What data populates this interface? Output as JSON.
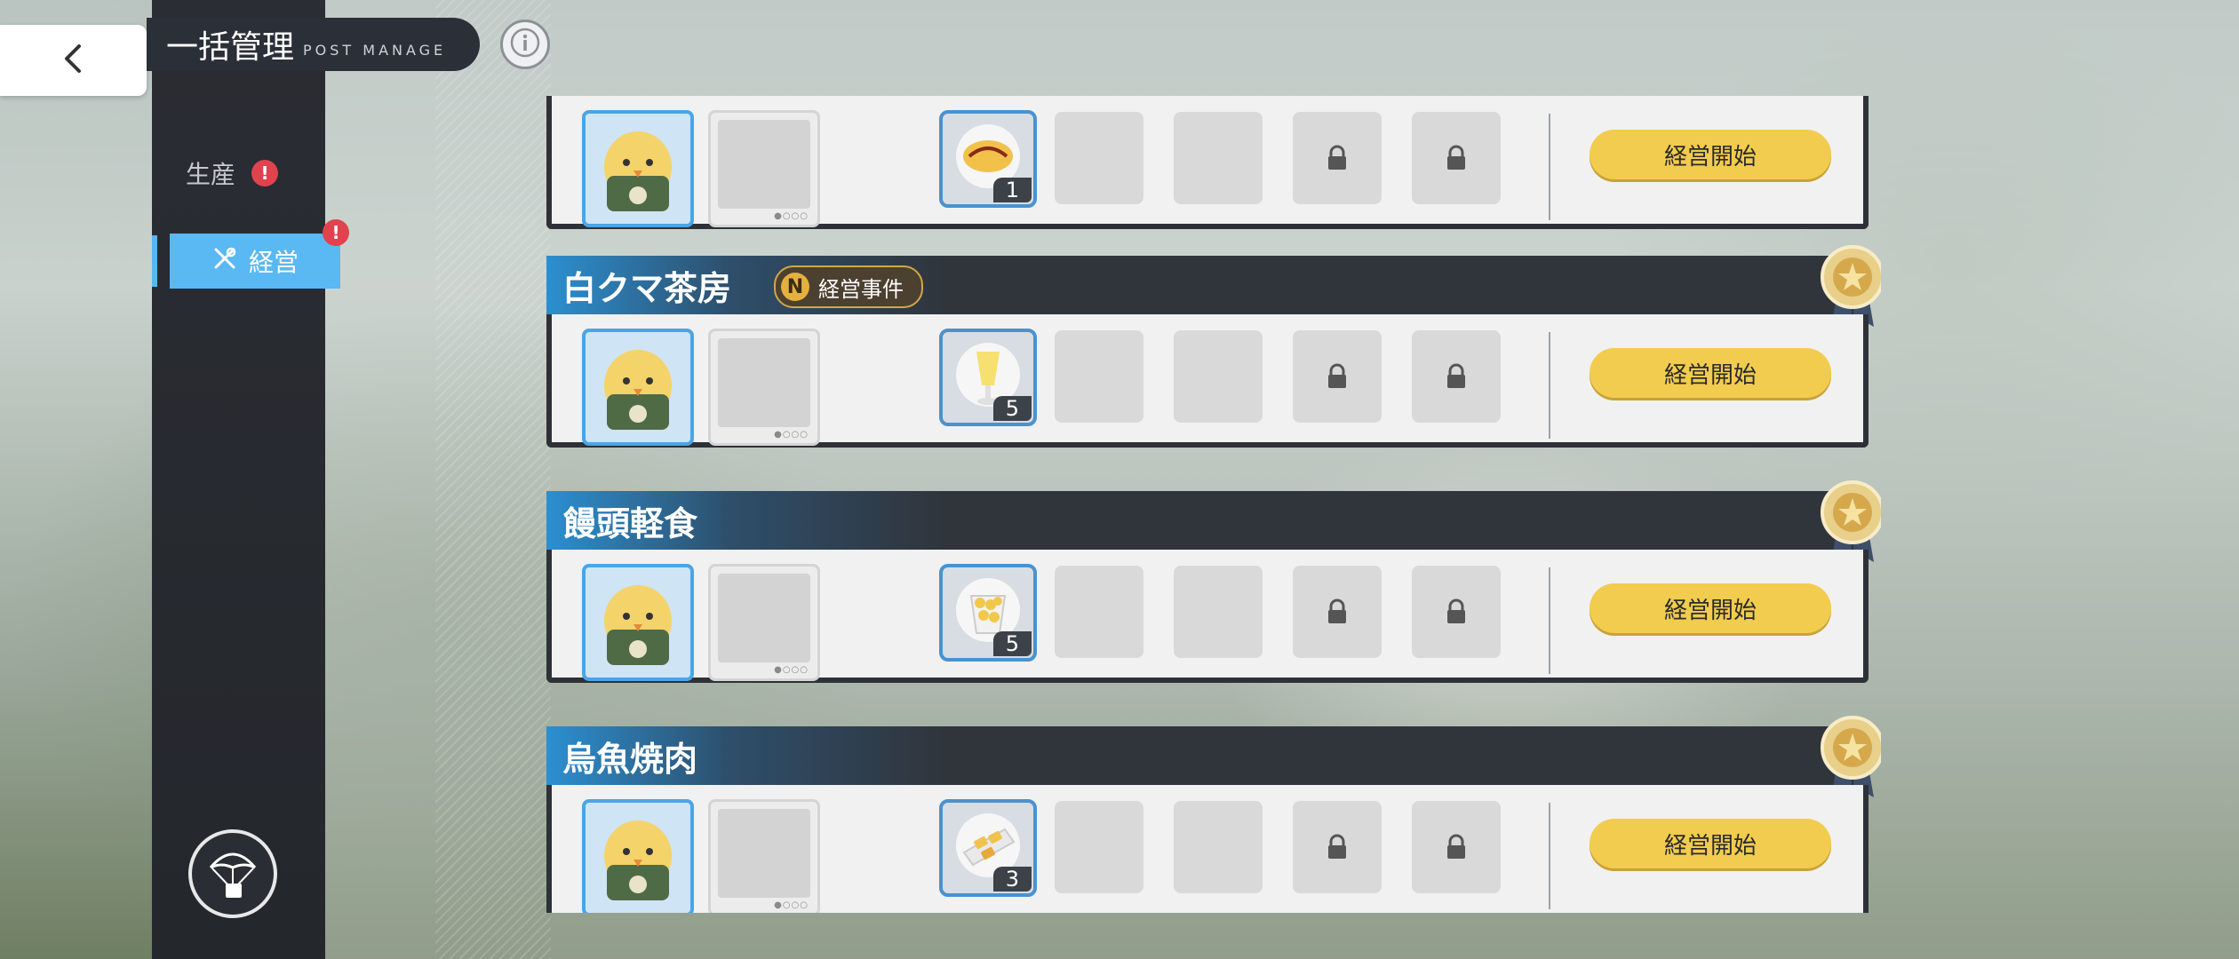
{
  "header": {
    "title": "一括管理",
    "subtitle": "POST MANAGE"
  },
  "sidebar": {
    "items": [
      {
        "label": "生産",
        "alert": "!"
      },
      {
        "label": "経営",
        "alert": "!"
      }
    ]
  },
  "cards": [
    {
      "name": "",
      "event": "",
      "item_count": "1",
      "button": "経営開始"
    },
    {
      "name": "白クマ茶房",
      "event": "経営事件",
      "event_rank": "N",
      "item_count": "5",
      "button": "経営開始"
    },
    {
      "name": "饅頭軽食",
      "event": "",
      "item_count": "5",
      "button": "経営開始"
    },
    {
      "name": "烏魚焼肉",
      "event": "",
      "item_count": "3",
      "button": "経営開始"
    }
  ],
  "colors": {
    "accent": "#5ab8f3",
    "button": "#f2cc4e",
    "alert": "#e0424e",
    "panel_dark": "#30353c"
  }
}
